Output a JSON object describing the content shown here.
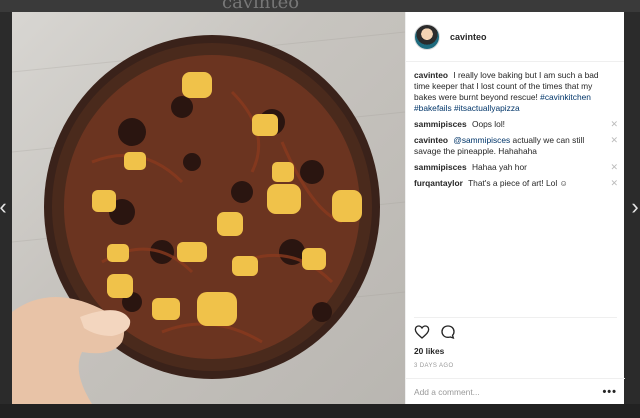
{
  "backdrop": {
    "brand": "cavinteo"
  },
  "nav": {
    "prev_glyph": "‹",
    "next_glyph": "›"
  },
  "post": {
    "username": "cavinteo",
    "caption_text": "I really love baking but I am such a bad time keeper that I lost count of the times that my bakes were burnt beyond rescue!",
    "hashtags": [
      "#cavinkitchen",
      "#bakefails",
      "#itsactuallyapizza"
    ],
    "likes": "20 likes",
    "time": "3 DAYS AGO",
    "comment_placeholder": "Add a comment...",
    "more": "•••"
  },
  "comments": [
    {
      "user": "sammipisces",
      "mention": "",
      "text": "Oops lol!",
      "removable": true
    },
    {
      "user": "cavinteo",
      "mention": "@sammipisces",
      "text": "actually we can still savage the pineapple. Hahahaha",
      "removable": true
    },
    {
      "user": "sammipisces",
      "mention": "",
      "text": "Hahaa yah hor",
      "removable": true
    },
    {
      "user": "furqantaylor",
      "mention": "",
      "text": "That's a piece of art! Lol ☺",
      "removable": true
    }
  ],
  "colors": {
    "link": "#003569",
    "muted": "#999999",
    "border": "#efefef"
  },
  "icons": {
    "like": "heart-icon",
    "comment": "comment-bubble-icon",
    "remove": "close-icon",
    "more": "more-options-icon"
  }
}
